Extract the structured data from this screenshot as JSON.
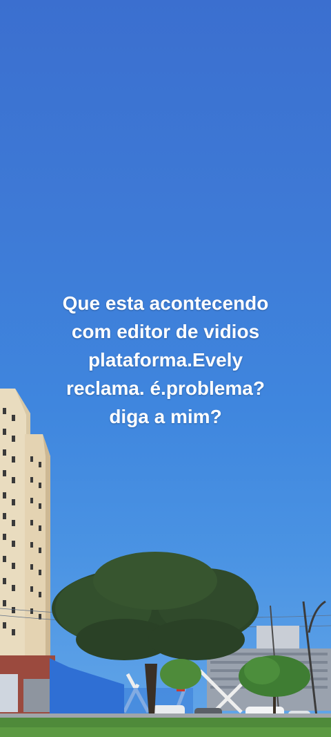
{
  "caption": {
    "lines": [
      "Que esta acontecendo",
      "com editor de vidios",
      "plataforma.Evely",
      "reclama. é.problema?",
      "diga a mim?"
    ]
  },
  "colors": {
    "sky_top": "#3b6fcf",
    "sky_bottom": "#63a6e8",
    "caption_text": "#ffffff",
    "building": "#e8dcc0",
    "tree_foliage": "#2f4a2c",
    "grass": "#4f8a3a"
  }
}
